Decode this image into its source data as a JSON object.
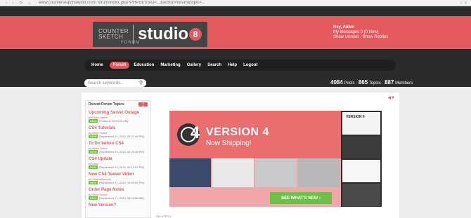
{
  "browser": {
    "nav_glyphs": "‹ › ⟳ ⌂",
    "url": "www.counterskatchstudio.com/ forum/index.php?PHPSESSID=...&action=forum&topic=...",
    "tools": "☆ ≡"
  },
  "logo": {
    "counter": "COUNTER",
    "sketch": "SKETCH",
    "studio": "studio",
    "badge": "8",
    "forum": "FORUM"
  },
  "user": {
    "greeting": "Hey, Adam",
    "messages": "My Messages 0 (0 New)",
    "links": "Show Unread · Show Replies"
  },
  "menu": {
    "items": [
      "Home",
      "Forum",
      "Education",
      "Marketing",
      "Gallery",
      "Search",
      "Help",
      "Logout"
    ]
  },
  "search": {
    "placeholder": "Search keywords..."
  },
  "stats": {
    "posts": "4084",
    "posts_label": "Posts",
    "topics": "865",
    "topics_label": "Topics",
    "members": "887",
    "members_label": "Members"
  },
  "recent": {
    "title": "Recent Forum Topics",
    "topics": [
      {
        "title": "Upcoming Server Outage",
        "by": "by",
        "author": "Brian Yoshe",
        "date": "[Today at 05:59:26 AM]"
      },
      {
        "title": "CS4 Tutorials",
        "by": "by",
        "author": "Brian Yoshe",
        "date": "[September 24, 2013, 03:27:45 PM]"
      },
      {
        "title": "To Do before CS4",
        "by": "by",
        "author": "Brian Yoshe",
        "date": "[September 24, 2013, 02:23:38 PM]"
      },
      {
        "title": "CS4 Update",
        "by": "by",
        "author": "raise",
        "date": "[September 24, 2013, 02:12:51 PM]"
      },
      {
        "title": "New CS4 Teaser Video",
        "by": "by",
        "author": "Desinationcorp",
        "date": "[September 21, 2013, 10:20:55 PM]"
      },
      {
        "title": "Order Page Notes",
        "by": "by",
        "author": "Brian Yoshe",
        "date": "[September 21, 2013, 08:22:08 AM]"
      },
      {
        "title": "New Version?",
        "by": "",
        "author": "",
        "date": ""
      }
    ],
    "new_badge": "NEW"
  },
  "promo": {
    "headline": "VERSION 4",
    "sub": "Now Shipping!",
    "digit": "4",
    "cta": "SEE WHAT'S NEW  ›"
  },
  "strip": {
    "first_label": "VERSION 4"
  },
  "footer_note": "RELATED A",
  "colors": {
    "accent": "#e4595d",
    "dark": "#2b2b2b",
    "green": "#6fbf4a"
  }
}
